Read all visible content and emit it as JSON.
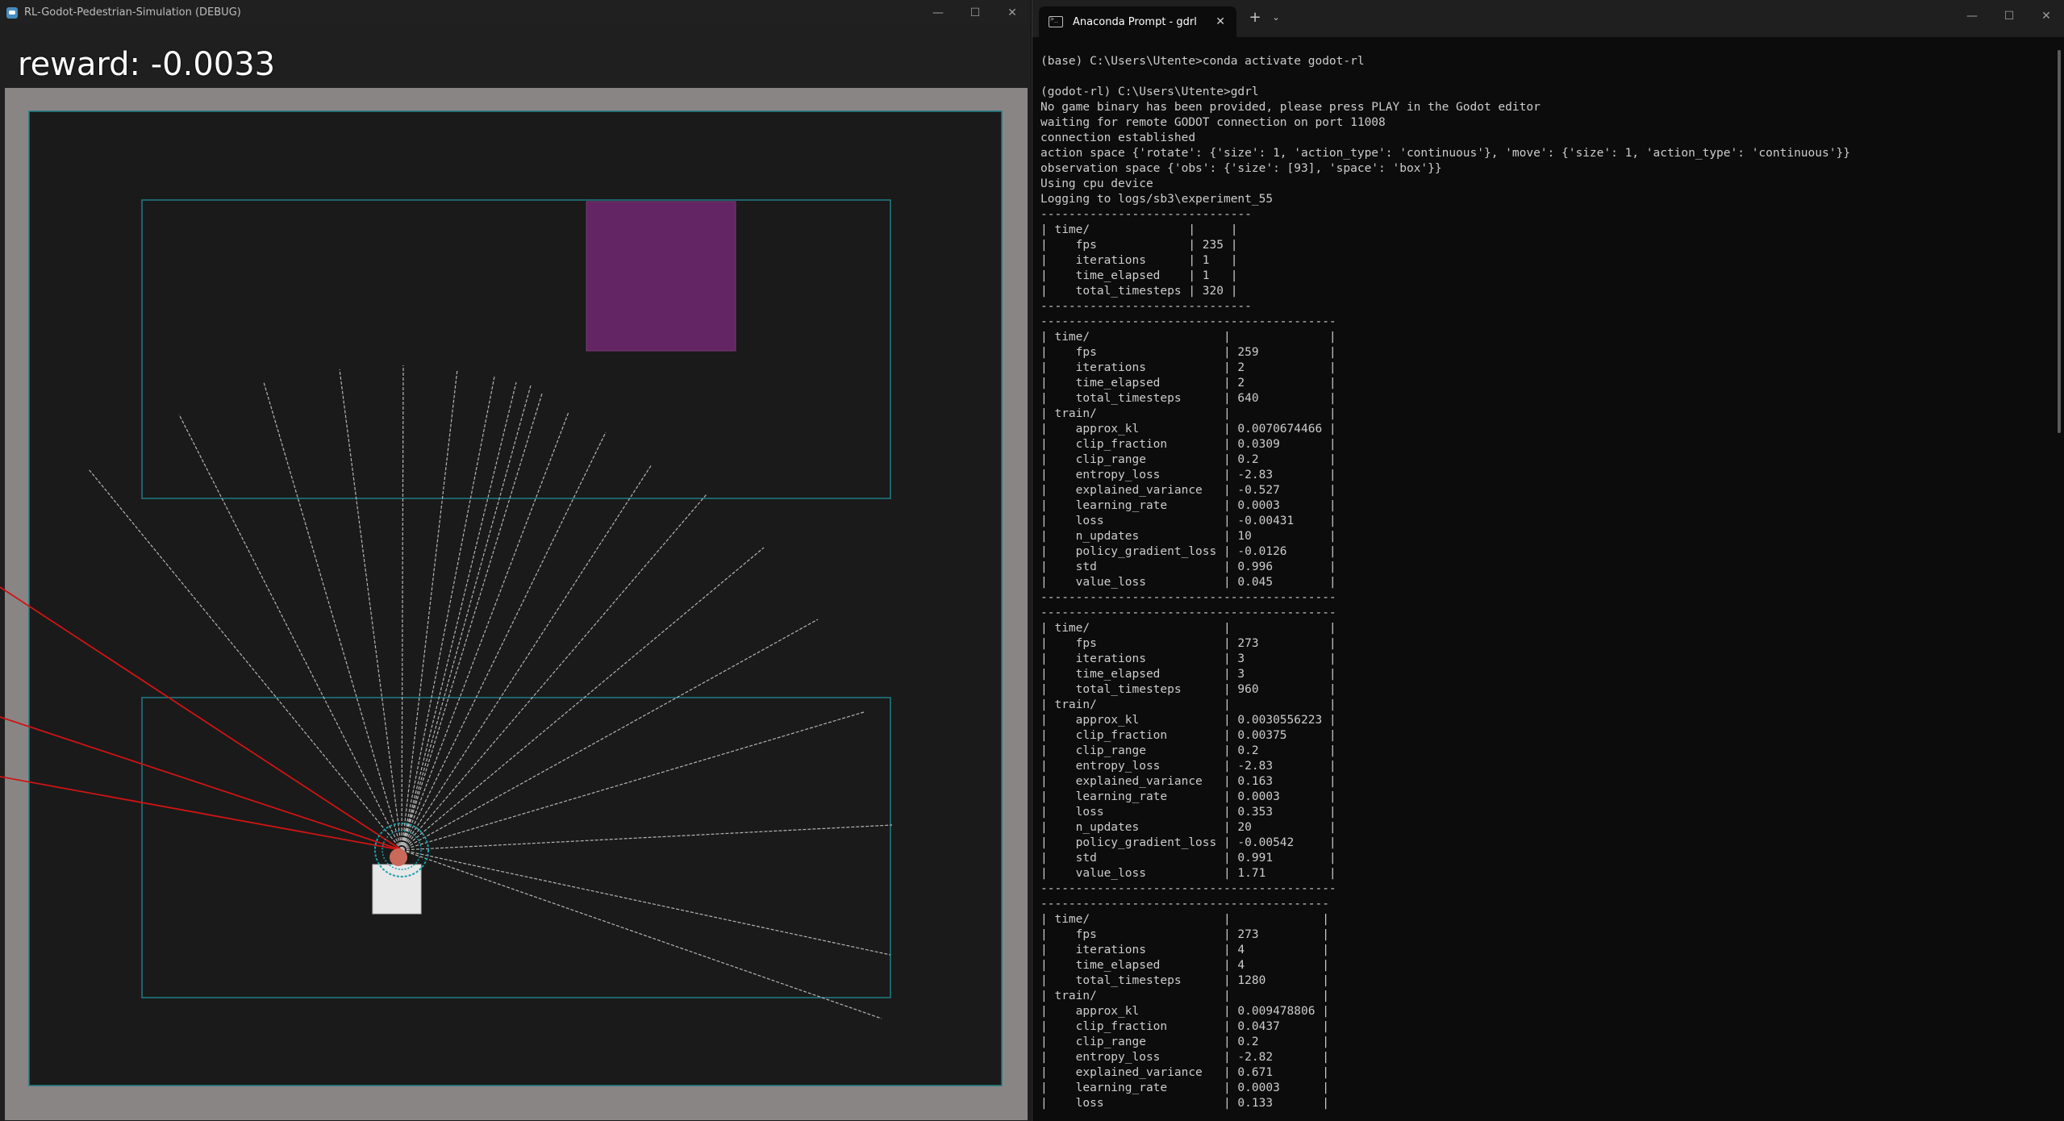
{
  "godot_window": {
    "title": "RL-Godot-Pedestrian-Simulation (DEBUG)",
    "icon": "godot-icon",
    "reward_text": "reward: -0.0033",
    "controls": {
      "minimize": "—",
      "maximize": "☐",
      "close": "✕"
    },
    "colors": {
      "background": "#1f1f1f",
      "arena_border": "#8f8f8f",
      "zone_outline": "#1e7d86",
      "target": "#632563",
      "ray": "#b4b4b4",
      "ray_hit": "#d01414",
      "agent_sensor": "#1aa0aa",
      "agent_box": "#e8e8e8"
    }
  },
  "terminal_window": {
    "tab_title": "Anaconda Prompt - gdrl",
    "tab_icon": "terminal-icon",
    "new_tab": "+",
    "dropdown": "⌄",
    "controls": {
      "minimize": "—",
      "maximize": "☐",
      "close": "✕"
    },
    "lines": [
      "(base) C:\\Users\\Utente>conda activate godot-rl",
      "",
      "(godot-rl) C:\\Users\\Utente>gdrl",
      "No game binary has been provided, please press PLAY in the Godot editor",
      "waiting for remote GODOT connection on port 11008",
      "connection established",
      "action space {'rotate': {'size': 1, 'action_type': 'continuous'}, 'move': {'size': 1, 'action_type': 'continuous'}}",
      "observation space {'obs': {'size': [93], 'space': 'box'}}",
      "Using cpu device",
      "Logging to logs/sb3\\experiment_55",
      "------------------------------",
      "| time/              |     |",
      "|    fps             | 235 |",
      "|    iterations      | 1   |",
      "|    time_elapsed    | 1   |",
      "|    total_timesteps | 320 |",
      "------------------------------",
      "------------------------------------------",
      "| time/                   |              |",
      "|    fps                  | 259          |",
      "|    iterations           | 2            |",
      "|    time_elapsed         | 2            |",
      "|    total_timesteps      | 640          |",
      "| train/                  |              |",
      "|    approx_kl            | 0.0070674466 |",
      "|    clip_fraction        | 0.0309       |",
      "|    clip_range           | 0.2          |",
      "|    entropy_loss         | -2.83        |",
      "|    explained_variance   | -0.527       |",
      "|    learning_rate        | 0.0003       |",
      "|    loss                 | -0.00431     |",
      "|    n_updates            | 10           |",
      "|    policy_gradient_loss | -0.0126      |",
      "|    std                  | 0.996        |",
      "|    value_loss           | 0.045        |",
      "------------------------------------------",
      "------------------------------------------",
      "| time/                   |              |",
      "|    fps                  | 273          |",
      "|    iterations           | 3            |",
      "|    time_elapsed         | 3            |",
      "|    total_timesteps      | 960          |",
      "| train/                  |              |",
      "|    approx_kl            | 0.0030556223 |",
      "|    clip_fraction        | 0.00375      |",
      "|    clip_range           | 0.2          |",
      "|    entropy_loss         | -2.83        |",
      "|    explained_variance   | 0.163        |",
      "|    learning_rate        | 0.0003       |",
      "|    loss                 | 0.353        |",
      "|    n_updates            | 20           |",
      "|    policy_gradient_loss | -0.00542     |",
      "|    std                  | 0.991        |",
      "|    value_loss           | 1.71         |",
      "------------------------------------------",
      "-----------------------------------------",
      "| time/                   |             |",
      "|    fps                  | 273         |",
      "|    iterations           | 4           |",
      "|    time_elapsed         | 4           |",
      "|    total_timesteps      | 1280        |",
      "| train/                  |             |",
      "|    approx_kl            | 0.009478806 |",
      "|    clip_fraction        | 0.0437      |",
      "|    clip_range           | 0.2         |",
      "|    entropy_loss         | -2.82       |",
      "|    explained_variance   | 0.671       |",
      "|    learning_rate        | 0.0003      |",
      "|    loss                 | 0.133       |"
    ]
  }
}
